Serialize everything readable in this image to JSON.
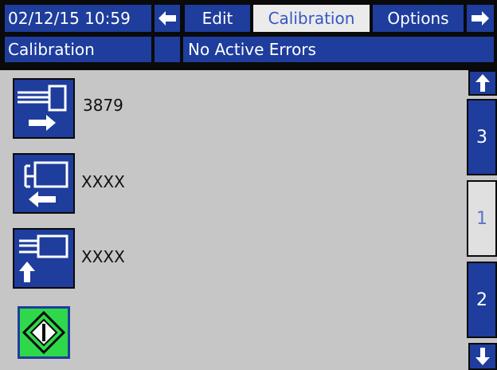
{
  "header": {
    "datetime": "02/12/15 10:59",
    "tabs": [
      {
        "label": "Edit",
        "active": false
      },
      {
        "label": "Calibration",
        "active": true
      },
      {
        "label": "Options",
        "active": false
      }
    ],
    "left_arrow_icon": "arrow-left-icon",
    "right_arrow_icon": "arrow-right-icon"
  },
  "status": {
    "screen_name": "Calibration",
    "message": "No Active Errors"
  },
  "rows": [
    {
      "icon": "extend-right-icon",
      "value": "3879"
    },
    {
      "icon": "retract-left-icon",
      "value": "XXXX"
    },
    {
      "icon": "clamp-up-icon",
      "value": "XXXX"
    }
  ],
  "start_icon": "start-diamond-icon",
  "pager": {
    "up_icon": "arrow-up-icon",
    "down_icon": "arrow-down-icon",
    "pages": [
      {
        "label": "3",
        "active": false
      },
      {
        "label": "1",
        "active": true
      },
      {
        "label": "2",
        "active": false
      }
    ]
  },
  "colors": {
    "bar_blue": "#1e3d9c",
    "panel_gray": "#c6c6c6",
    "start_green": "#2fd84a"
  }
}
